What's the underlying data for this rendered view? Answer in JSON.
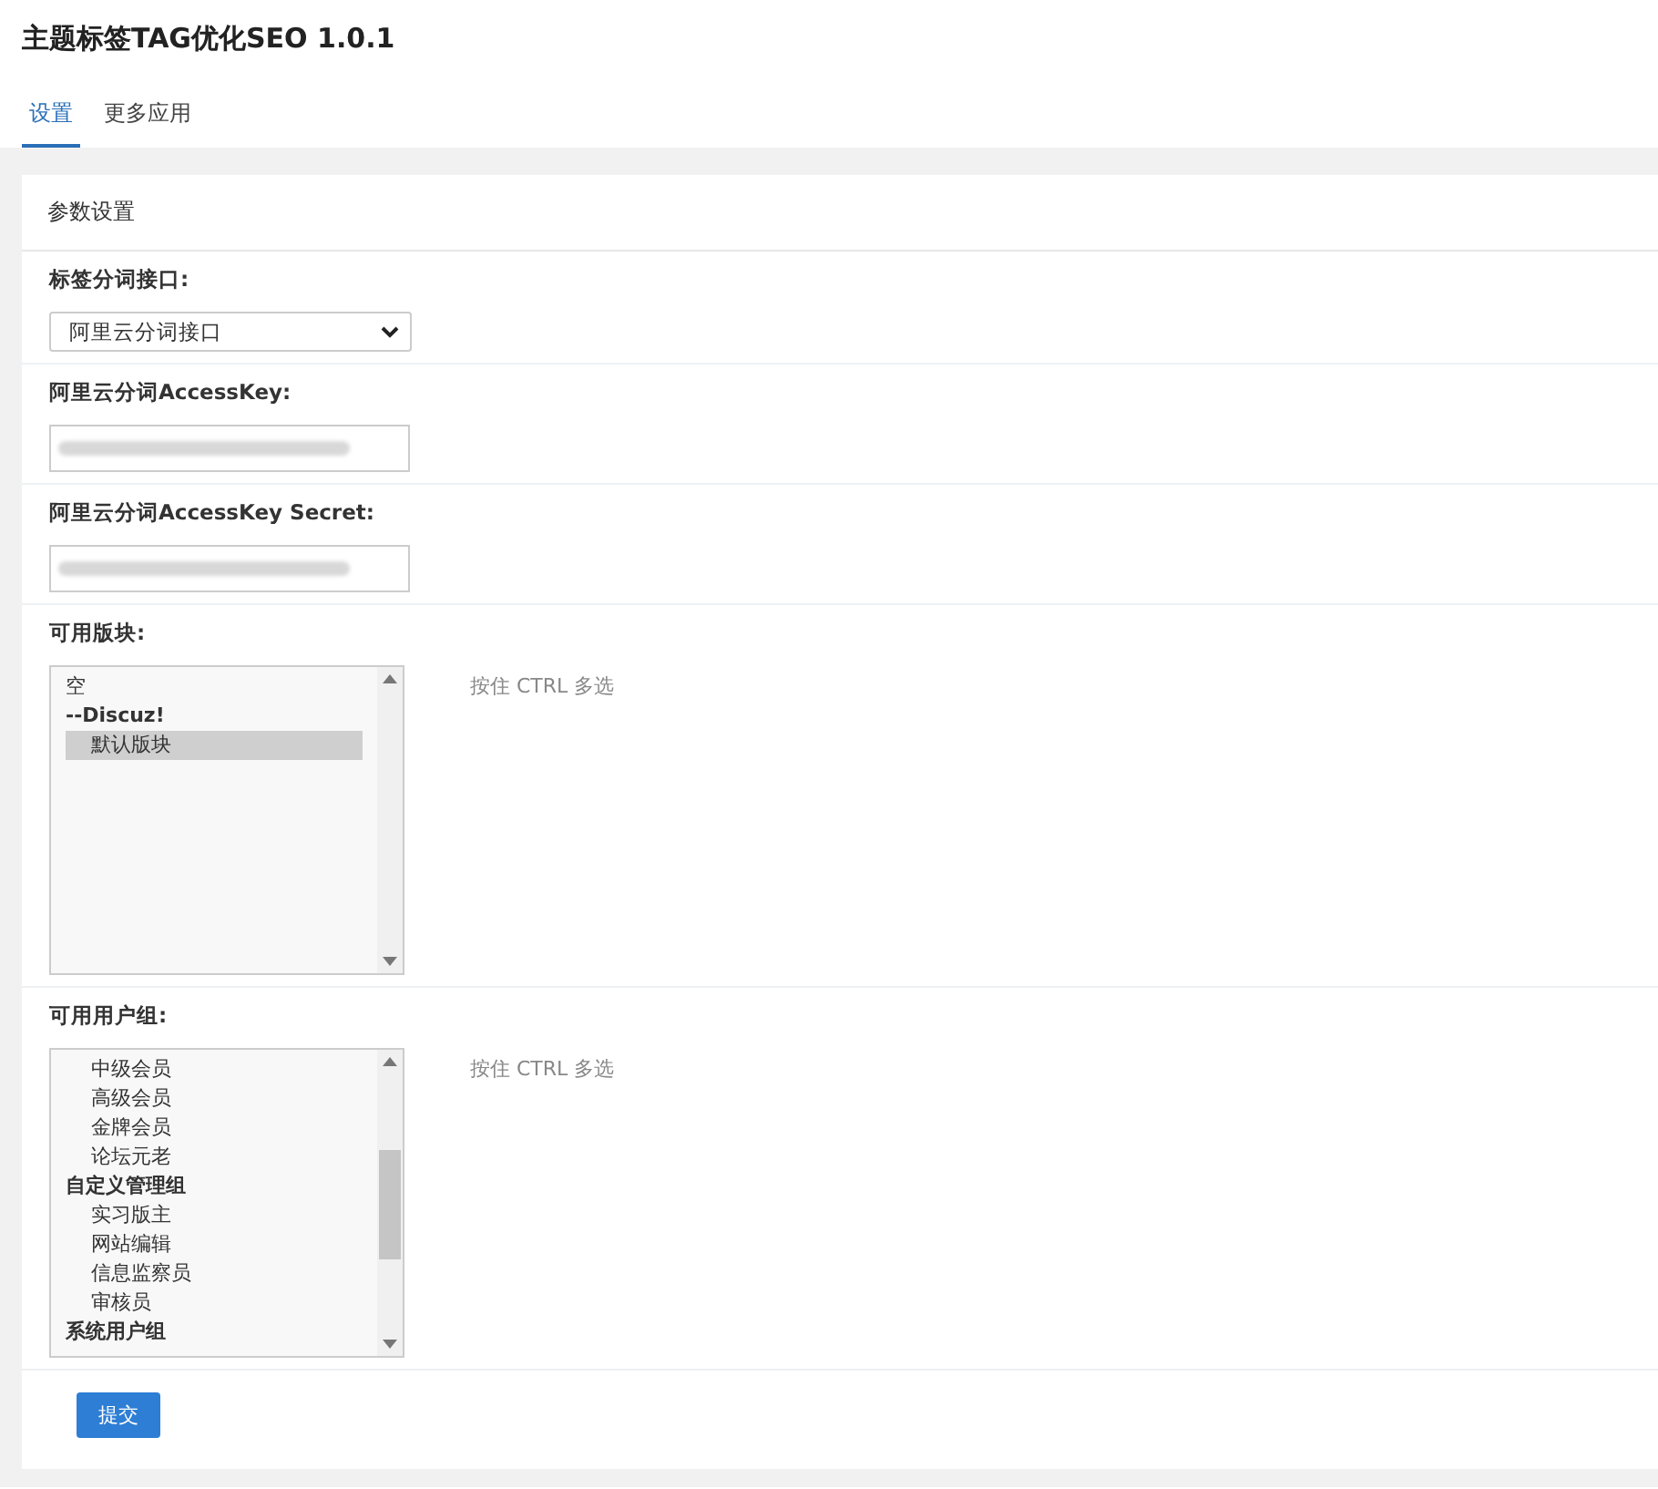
{
  "title": "主题标签TAG优化SEO 1.0.1",
  "tabs": [
    {
      "label": "设置",
      "selected": true
    },
    {
      "label": "更多应用",
      "selected": false
    }
  ],
  "card_title": "参数设置",
  "fields": [
    {
      "kind": "select",
      "label": "标签分词接口:",
      "value": "阿里云分词接口"
    },
    {
      "kind": "input",
      "label": "阿里云分词AccessKey:"
    },
    {
      "kind": "input",
      "label": "阿里云分词AccessKey Secret:"
    },
    {
      "kind": "listbox",
      "label": "可用版块:",
      "hint": "按住 CTRL 多选",
      "scrolled": false,
      "options": [
        {
          "kind": "plain",
          "text": "空",
          "selected": false
        },
        {
          "kind": "group",
          "text": "--Discuz!",
          "selected": false
        },
        {
          "kind": "child",
          "text": "默认版块",
          "selected": true
        }
      ]
    },
    {
      "kind": "listbox",
      "label": "可用用户组:",
      "hint": "按住 CTRL 多选",
      "scrolled": true,
      "options": [
        {
          "kind": "child",
          "text": "中级会员",
          "selected": false
        },
        {
          "kind": "child",
          "text": "高级会员",
          "selected": false
        },
        {
          "kind": "child",
          "text": "金牌会员",
          "selected": false
        },
        {
          "kind": "child",
          "text": "论坛元老",
          "selected": false
        },
        {
          "kind": "group",
          "text": "自定义管理组",
          "selected": false
        },
        {
          "kind": "child",
          "text": "实习版主",
          "selected": false
        },
        {
          "kind": "child",
          "text": "网站编辑",
          "selected": false
        },
        {
          "kind": "child",
          "text": "信息监察员",
          "selected": false
        },
        {
          "kind": "child",
          "text": "审核员",
          "selected": false
        },
        {
          "kind": "group",
          "text": "系统用户组",
          "selected": false
        }
      ]
    }
  ],
  "submit": "提交"
}
